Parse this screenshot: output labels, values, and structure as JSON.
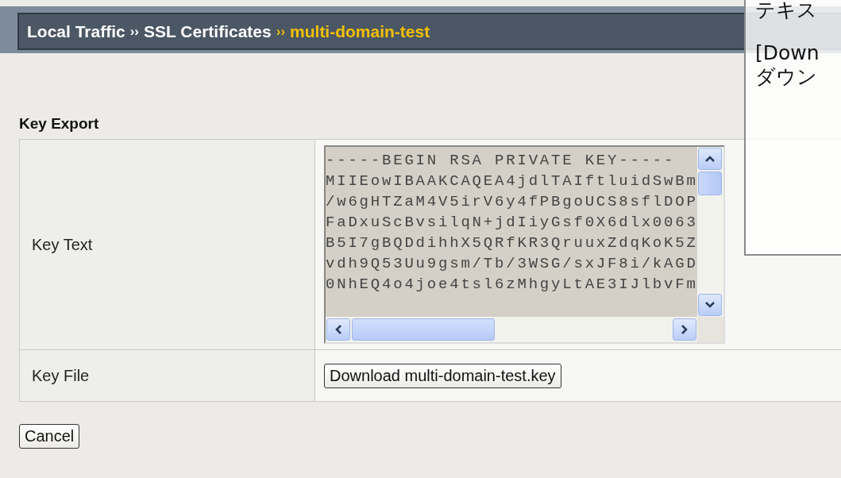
{
  "breadcrumb": [
    {
      "label": "Local Traffic",
      "current": false
    },
    {
      "label": "SSL Certificates",
      "current": false
    },
    {
      "label": "multi-domain-test",
      "current": true
    }
  ],
  "separator": "››",
  "section_title": "Key Export",
  "rows": [
    {
      "kind": "textarea",
      "label": "Key Text",
      "lines": [
        "-----BEGIN RSA PRIVATE KEY-----",
        "MIIEowIBAAKCAQEA4jdlTAIftluidSwBm",
        "/w6gHTZaM4V5irV6y4fPBgoUCS8sflDOP",
        "FaDxuScBvsilqN+jdIiyGsf0X6dlx0063",
        "B5I7gBQDdihhX5QRfKR3QruuxZdqKoK5Z",
        "vdh9Q53Uu9gsm/Tb/3WSG/sxJF8i/kAGD",
        "0NhEQ4o4joe4tsl6zMhgyLtAE3IJlbvFm"
      ]
    },
    {
      "kind": "button",
      "label": "Key File",
      "button": "Download multi-domain-test.key"
    }
  ],
  "cancel_button": "Cancel",
  "callout": {
    "lines": [
      "テキス",
      "[Down",
      "ダウン"
    ]
  }
}
